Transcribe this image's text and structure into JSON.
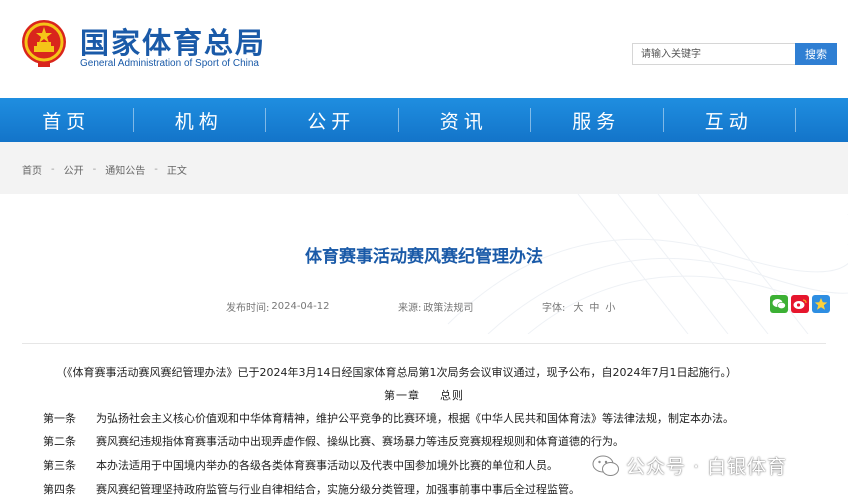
{
  "header": {
    "title": "国家体育总局",
    "subtitle": "General Administration of Sport of China",
    "search": {
      "placeholder": "请输入关键字",
      "button": "搜索"
    }
  },
  "nav": {
    "items": [
      "首页",
      "机构",
      "公开",
      "资讯",
      "服务",
      "互动"
    ]
  },
  "breadcrumb": [
    "首页",
    "公开",
    "通知公告",
    "正文"
  ],
  "article": {
    "title": "体育赛事活动赛风赛纪管理办法",
    "meta": {
      "date_label": "发布时间:",
      "date": "2024-04-12",
      "source_label": "来源:",
      "source": "政策法规司",
      "font_label": "字体:",
      "font_sizes": [
        "大",
        "中",
        "小"
      ]
    },
    "share_icons": [
      "wechat-icon",
      "weibo-icon",
      "qzone-icon"
    ],
    "intro": "（《体育赛事活动赛风赛纪管理办法》已于2024年3月14日经国家体育总局第1次局务会议审议通过，现予公布，自2024年7月1日起施行。）",
    "chapter": {
      "num": "第一章",
      "name": "总则"
    },
    "clauses": [
      {
        "num": "第一条",
        "text": "为弘扬社会主义核心价值观和中华体育精神，维护公平竞争的比赛环境，根据《中华人民共和国体育法》等法律法规，制定本办法。"
      },
      {
        "num": "第二条",
        "text": "赛风赛纪违规指体育赛事活动中出现弄虚作假、操纵比赛、赛场暴力等违反竞赛规程规则和体育道德的行为。"
      },
      {
        "num": "第三条",
        "text": "本办法适用于中国境内举办的各级各类体育赛事活动以及代表中国参加境外比赛的单位和人员。"
      },
      {
        "num": "第四条",
        "text": "赛风赛纪管理坚持政府监管与行业自律相结合，实施分级分类管理，加强事前事中事后全过程监管。"
      }
    ]
  },
  "watermark": "公众号 · 白银体育",
  "colors": {
    "brand": "#1a5aa8",
    "nav": "#1a82d8",
    "search_button": "#2f7fd3"
  }
}
